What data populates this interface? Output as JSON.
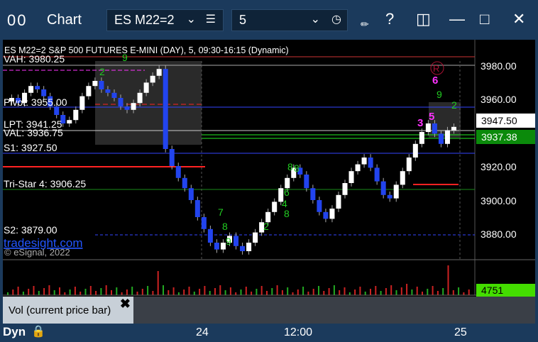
{
  "window": {
    "icon_text": "00",
    "title": "Chart",
    "symbol": "ES M22=2",
    "interval": "5"
  },
  "chart": {
    "header": "ES M22=2 S&P 500 FUTURES E-MINI (DAY), 5, 09:30-16:15 (Dynamic)",
    "levels": [
      {
        "label": "VAH: 3980.25"
      },
      {
        "label": "Pivot: 3955.00"
      },
      {
        "label": "LPT: 3941.25"
      },
      {
        "label": "VAL: 3936.75"
      },
      {
        "label": "S1: 3927.50"
      },
      {
        "label": "Tri-Star 4: 3906.25"
      },
      {
        "label": "S2: 3879.00"
      }
    ],
    "brand": "tradesight.com",
    "copyright": "© eSignal, 2022",
    "y_ticks": [
      "3980.00",
      "3960.00",
      "3920.00",
      "3900.00",
      "3880.00"
    ],
    "last_price": "3947.50",
    "tag_price": "3937.38",
    "volume_label": "4751",
    "x_labels": [
      "24",
      "12:00",
      "25"
    ],
    "counts": [
      "2",
      "9",
      "6",
      "9",
      "2",
      "3",
      "5",
      "8",
      "7",
      "8",
      "9",
      "6",
      "8",
      "4",
      "2",
      "8"
    ],
    "r_mark": "R"
  },
  "vol_panel": {
    "label": "Vol (current price bar)",
    "close": "✖"
  },
  "status": {
    "mode": "Dyn"
  },
  "colors": {
    "bull": "#ffffff",
    "bear": "#2244ee",
    "bg": "#000000",
    "frame": "#1b3a5c",
    "green_tag": "#0b8a0b",
    "lime": "#00dd00"
  },
  "chart_data": {
    "type": "candlestick",
    "title": "ES M22=2 S&P 500 FUTURES E-MINI (DAY), 5, 09:30-16:15 (Dynamic)",
    "ylim": [
      3870,
      3995
    ],
    "closes": [
      3965,
      3962,
      3968,
      3972,
      3970,
      3966,
      3960,
      3955,
      3950,
      3952,
      3958,
      3966,
      3972,
      3975,
      3970,
      3968,
      3965,
      3960,
      3958,
      3962,
      3968,
      3974,
      3978,
      3982,
      3935,
      3925,
      3918,
      3912,
      3905,
      3895,
      3888,
      3880,
      3876,
      3880,
      3884,
      3878,
      3875,
      3880,
      3886,
      3892,
      3898,
      3904,
      3912,
      3918,
      3924,
      3920,
      3912,
      3905,
      3898,
      3894,
      3900,
      3908,
      3915,
      3922,
      3926,
      3930,
      3924,
      3916,
      3908,
      3906,
      3914,
      3922,
      3930,
      3938,
      3945,
      3950,
      3944,
      3938,
      3946,
      3948
    ]
  }
}
